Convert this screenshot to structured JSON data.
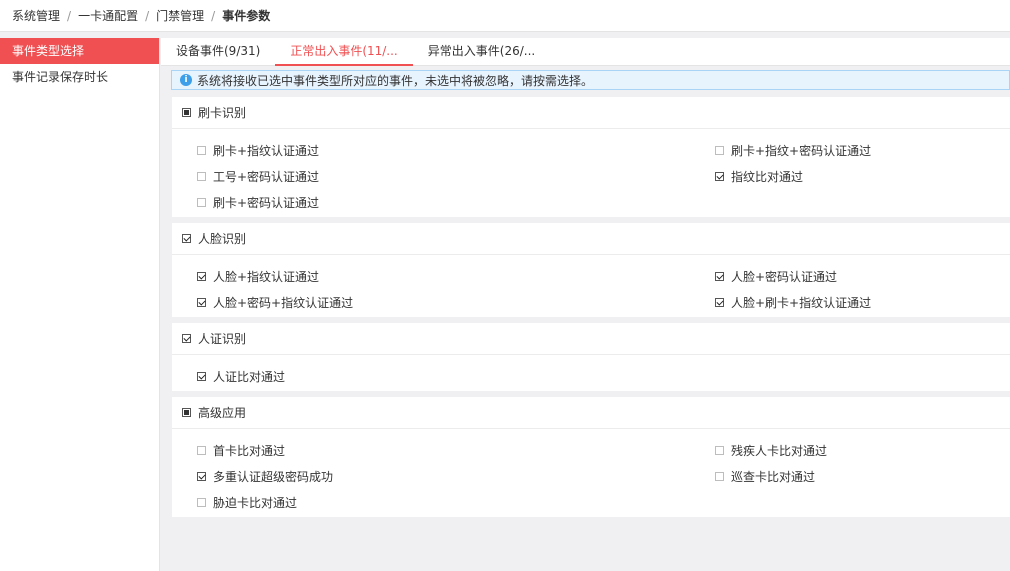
{
  "breadcrumb": [
    "系统管理",
    "一卡通配置",
    "门禁管理",
    "事件参数"
  ],
  "sidebar": {
    "items": [
      {
        "label": "事件类型选择",
        "active": true
      },
      {
        "label": "事件记录保存时长",
        "active": false
      }
    ]
  },
  "tabs": [
    {
      "label": "设备事件(9/31)",
      "active": false
    },
    {
      "label": "正常出入事件(11/...",
      "active": true
    },
    {
      "label": "异常出入事件(26/...",
      "active": false
    }
  ],
  "info": {
    "icon": "info-icon",
    "text": "系统将接收已选中事件类型所对应的事件，未选中将被忽略，请按需选择。"
  },
  "groups": [
    {
      "title": "刷卡识别",
      "state": "partial",
      "rows": [
        [
          {
            "label": "刷卡+指纹认证通过",
            "checked": false
          },
          {
            "label": "刷卡+指纹+密码认证通过",
            "checked": false
          }
        ],
        [
          {
            "label": "工号+密码认证通过",
            "checked": false
          },
          {
            "label": "指纹比对通过",
            "checked": true
          }
        ],
        [
          {
            "label": "刷卡+密码认证通过",
            "checked": false
          }
        ]
      ]
    },
    {
      "title": "人脸识别",
      "state": "checked",
      "rows": [
        [
          {
            "label": "人脸+指纹认证通过",
            "checked": true
          },
          {
            "label": "人脸+密码认证通过",
            "checked": true
          }
        ],
        [
          {
            "label": "人脸+密码+指纹认证通过",
            "checked": true
          },
          {
            "label": "人脸+刷卡+指纹认证通过",
            "checked": true
          }
        ]
      ]
    },
    {
      "title": "人证识别",
      "state": "checked",
      "rows": [
        [
          {
            "label": "人证比对通过",
            "checked": true
          }
        ]
      ]
    },
    {
      "title": "高级应用",
      "state": "partial",
      "rows": [
        [
          {
            "label": "首卡比对通过",
            "checked": false
          },
          {
            "label": "残疾人卡比对通过",
            "checked": false
          }
        ],
        [
          {
            "label": "多重认证超级密码成功",
            "checked": true
          },
          {
            "label": "巡查卡比对通过",
            "checked": false
          }
        ],
        [
          {
            "label": "胁迫卡比对通过",
            "checked": false
          }
        ]
      ]
    }
  ]
}
